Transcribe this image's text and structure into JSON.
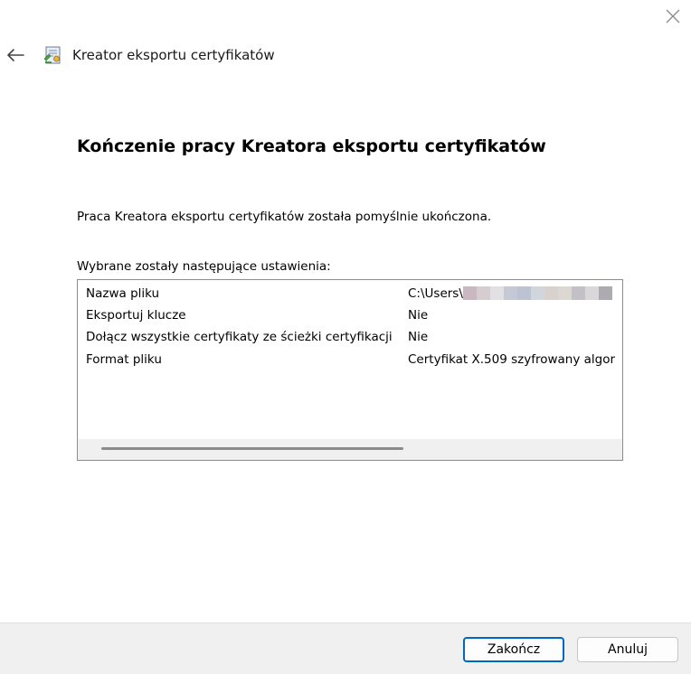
{
  "window": {
    "title": "Kreator eksportu certyfikatów",
    "icons": {
      "close": "close-icon",
      "back": "back-arrow-icon",
      "wizard": "certificate-wizard-icon"
    }
  },
  "page": {
    "heading": "Kończenie pracy Kreatora eksportu certyfikatów",
    "message": "Praca Kreatora eksportu certyfikatów została pomyślnie ukończona.",
    "settings_label": "Wybrane zostały następujące ustawienia:"
  },
  "settings": [
    {
      "name": "Nazwa pliku",
      "value": "C:\\Users\\"
    },
    {
      "name": "Eksportuj klucze",
      "value": "Nie"
    },
    {
      "name": "Dołącz wszystkie certyfikaty ze ścieżki certyfikacji",
      "value": "Nie"
    },
    {
      "name": "Format pliku",
      "value": "Certyfikat X.509 szyfrowany algor"
    }
  ],
  "redaction_colors": [
    "#c9b7c2",
    "#d6cdd1",
    "#e1e1e5",
    "#c5c8d5",
    "#bec3d3",
    "#d1d6dd",
    "#d8d2cf",
    "#ddd7d2",
    "#c3c0c7",
    "#d8d8db",
    "#adaab1"
  ],
  "footer": {
    "finish_label": "Zakończ",
    "cancel_label": "Anuluj"
  },
  "colors": {
    "accent": "#0067c0",
    "footer_bg": "#f0f0f0",
    "border": "#8c8c8c"
  }
}
